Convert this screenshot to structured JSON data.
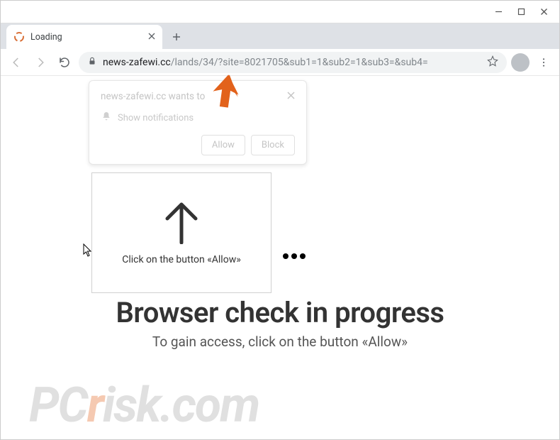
{
  "window": {
    "tab_title": "Loading"
  },
  "toolbar": {
    "url_domain": "news-zafewi.cc",
    "url_path": "/lands/34/?site=8021705&sub1=1&sub2=1&sub3=&sub4="
  },
  "permission": {
    "origin_text": "news-zafewi.cc wants to",
    "feature_text": "Show notifications",
    "allow_label": "Allow",
    "block_label": "Block"
  },
  "instruction": {
    "card_text": "Click on the button «Allow»"
  },
  "headline": {
    "title": "Browser check in progress",
    "subtitle": "To gain access, click on the button «Allow»"
  },
  "watermark": {
    "text_pc": "PC",
    "text_r": "r",
    "text_rest": "isk.com"
  }
}
